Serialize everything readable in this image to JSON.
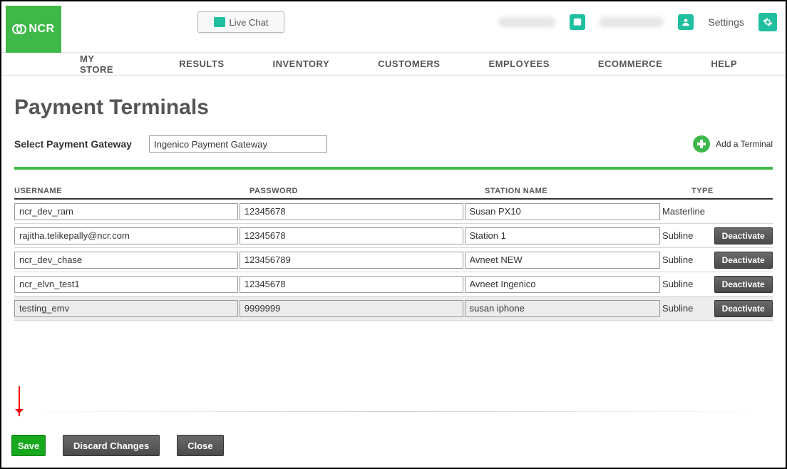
{
  "header": {
    "brand": "NCR",
    "livechat_label": "Live Chat",
    "settings_label": "Settings"
  },
  "nav": {
    "items": [
      "MY STORE",
      "RESULTS",
      "INVENTORY",
      "CUSTOMERS",
      "EMPLOYEES",
      "ECOMMERCE",
      "HELP"
    ]
  },
  "page": {
    "title": "Payment Terminals",
    "gateway_label": "Select Payment Gateway",
    "gateway_value": "Ingenico Payment Gateway",
    "add_terminal_label": "Add a Terminal"
  },
  "table": {
    "columns": {
      "username": "USERNAME",
      "password": "PASSWORD",
      "station": "STATION NAME",
      "type": "TYPE"
    },
    "deactivate_label": "Deactivate",
    "rows": [
      {
        "username": "ncr_dev_ram",
        "password": "12345678",
        "station": "Susan PX10",
        "type": "Masterline",
        "deactivate": false,
        "dirty": false
      },
      {
        "username": "rajitha.telikepally@ncr.com",
        "password": "12345678",
        "station": "Station 1",
        "type": "Subline",
        "deactivate": true,
        "dirty": false
      },
      {
        "username": "ncr_dev_chase",
        "password": "123456789",
        "station": "Avneet NEW",
        "type": "Subline",
        "deactivate": true,
        "dirty": false
      },
      {
        "username": "ncr_elvn_test1",
        "password": "12345678",
        "station": "Avneet Ingenico",
        "type": "Subline",
        "deactivate": true,
        "dirty": false
      },
      {
        "username": "testing_emv",
        "password": "9999999",
        "station": "susan iphone",
        "type": "Subline",
        "deactivate": true,
        "dirty": true
      }
    ]
  },
  "footer": {
    "save": "Save",
    "discard": "Discard Changes",
    "close": "Close"
  }
}
